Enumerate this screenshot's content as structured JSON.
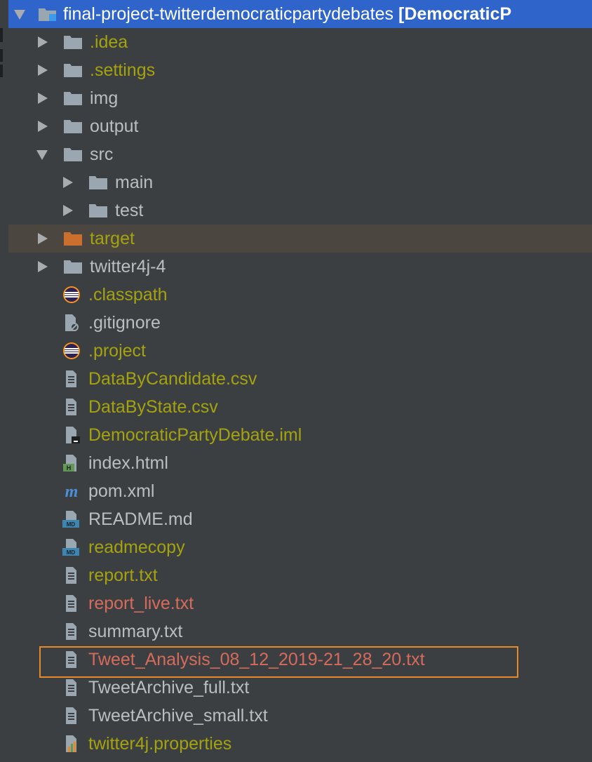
{
  "colors": {
    "background": "#3c3f41",
    "default_text": "#bbbdbf",
    "olive_text": "#a4a30f",
    "red_text": "#d66b5c",
    "selection": "#2f65ca",
    "focus_border": "#e6892b",
    "target_folder": "#cb6f2c"
  },
  "root": {
    "name": "final-project-twitterdemocraticpartydebates",
    "module": "[DemocraticP",
    "expanded": true,
    "icon": "project-folder-icon"
  },
  "items": [
    {
      "label": ".idea",
      "icon": "folder-icon",
      "status": "olive",
      "expandable": true,
      "expanded": false
    },
    {
      "label": ".settings",
      "icon": "folder-icon",
      "status": "olive",
      "expandable": true,
      "expanded": false
    },
    {
      "label": "img",
      "icon": "folder-icon",
      "status": "default",
      "expandable": true,
      "expanded": false
    },
    {
      "label": "output",
      "icon": "folder-icon",
      "status": "default",
      "expandable": true,
      "expanded": false
    },
    {
      "label": "src",
      "icon": "folder-icon",
      "status": "default",
      "expandable": true,
      "expanded": true
    },
    {
      "label": "main",
      "icon": "folder-icon",
      "status": "default",
      "expandable": true,
      "expanded": false
    },
    {
      "label": "test",
      "icon": "folder-icon",
      "status": "default",
      "expandable": true,
      "expanded": false
    },
    {
      "label": "target",
      "icon": "excluded-folder-icon",
      "status": "olive",
      "expandable": true,
      "expanded": false
    },
    {
      "label": "twitter4j-4",
      "icon": "folder-icon",
      "status": "default",
      "expandable": true,
      "expanded": false
    },
    {
      "label": ".classpath",
      "icon": "eclipse-icon",
      "status": "olive"
    },
    {
      "label": ".gitignore",
      "icon": "ignored-file-icon",
      "status": "default"
    },
    {
      "label": ".project",
      "icon": "eclipse-icon",
      "status": "olive"
    },
    {
      "label": "DataByCandidate.csv",
      "icon": "text-file-icon",
      "status": "olive"
    },
    {
      "label": "DataByState.csv",
      "icon": "text-file-icon",
      "status": "olive"
    },
    {
      "label": "DemocraticPartyDebate.iml",
      "icon": "module-file-icon",
      "status": "olive"
    },
    {
      "label": "index.html",
      "icon": "html-file-icon",
      "status": "default"
    },
    {
      "label": "pom.xml",
      "icon": "maven-icon",
      "status": "default"
    },
    {
      "label": "README.md",
      "icon": "markdown-file-icon",
      "status": "default"
    },
    {
      "label": "readmecopy",
      "icon": "markdown-file-icon",
      "status": "olive"
    },
    {
      "label": "report.txt",
      "icon": "text-file-icon",
      "status": "olive"
    },
    {
      "label": "report_live.txt",
      "icon": "text-file-icon",
      "status": "red"
    },
    {
      "label": "summary.txt",
      "icon": "text-file-icon",
      "status": "default"
    },
    {
      "label": "Tweet_Analysis_08_12_2019-21_28_20.txt",
      "icon": "text-file-icon",
      "status": "red"
    },
    {
      "label": "TweetArchive_full.txt",
      "icon": "text-file-icon",
      "status": "default"
    },
    {
      "label": "TweetArchive_small.txt",
      "icon": "text-file-icon",
      "status": "default"
    },
    {
      "label": "twitter4j.properties",
      "icon": "properties-file-icon",
      "status": "olive"
    }
  ]
}
